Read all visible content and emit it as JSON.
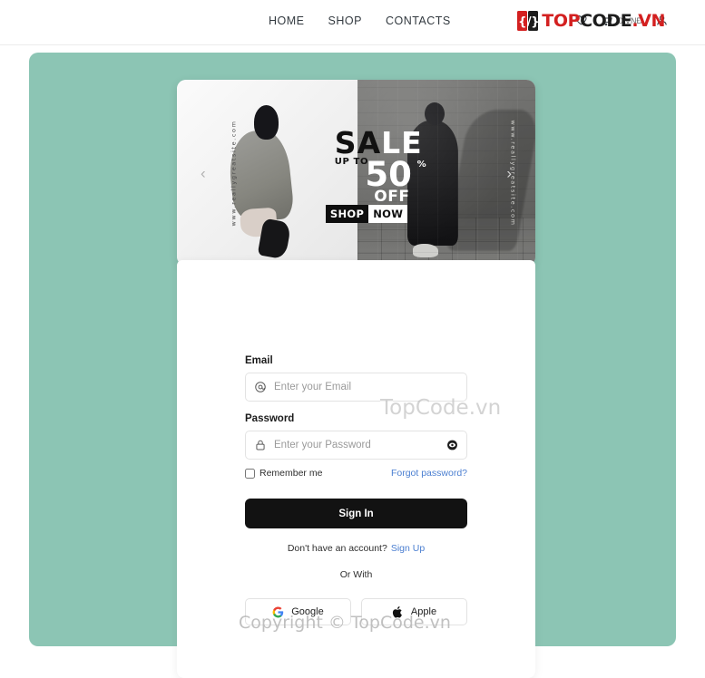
{
  "header": {
    "nav": [
      {
        "label": "HOME",
        "name": "nav-home"
      },
      {
        "label": "SHOP",
        "name": "nav-shop"
      },
      {
        "label": "CONTACTS",
        "name": "nav-contacts"
      }
    ],
    "cart_price": "0 VNĐ",
    "icons": {
      "wishlist": "heart-icon",
      "cart": "cart-icon",
      "account": "user-icon"
    },
    "brand": {
      "mark": "{/}",
      "top": "TOP",
      "code": "CODE",
      "vn": ".VN"
    }
  },
  "banner": {
    "sale_dark": "SA",
    "sale_light": "LE",
    "up_to": "UP TO",
    "percent_value": "50",
    "percent_sign": "%",
    "off": "OFF",
    "shop": "SHOP",
    "now": "NOW",
    "url_left": "www.reallygreatsite.com",
    "url_right": "www.reallygreatsite.com",
    "arrow_prev": "‹",
    "arrow_next": "›"
  },
  "form": {
    "email_label": "Email",
    "email_placeholder": "Enter your Email",
    "email_value": "",
    "email_icon": "at-sign-icon",
    "password_label": "Password",
    "password_placeholder": "Enter your Password",
    "password_value": "",
    "password_icon": "lock-icon",
    "toggle_icon": "eye-icon",
    "remember_label": "Remember me",
    "remember_checked": false,
    "forgot_label": "Forgot password?",
    "signin_label": "Sign In",
    "no_account_text": "Don't have an account?",
    "signup_label": "Sign Up",
    "or_with_label": "Or With",
    "social": [
      {
        "label": "Google",
        "icon": "google-icon"
      },
      {
        "label": "Apple",
        "icon": "apple-icon"
      }
    ]
  },
  "watermarks": {
    "middle": "TopCode.vn",
    "bottom": "Copyright © TopCode.vn"
  },
  "colors": {
    "stage_teal": "#8cc5b4",
    "brand_red": "#d32020",
    "link_blue": "#4b7fd1",
    "button_dark": "#121212"
  }
}
